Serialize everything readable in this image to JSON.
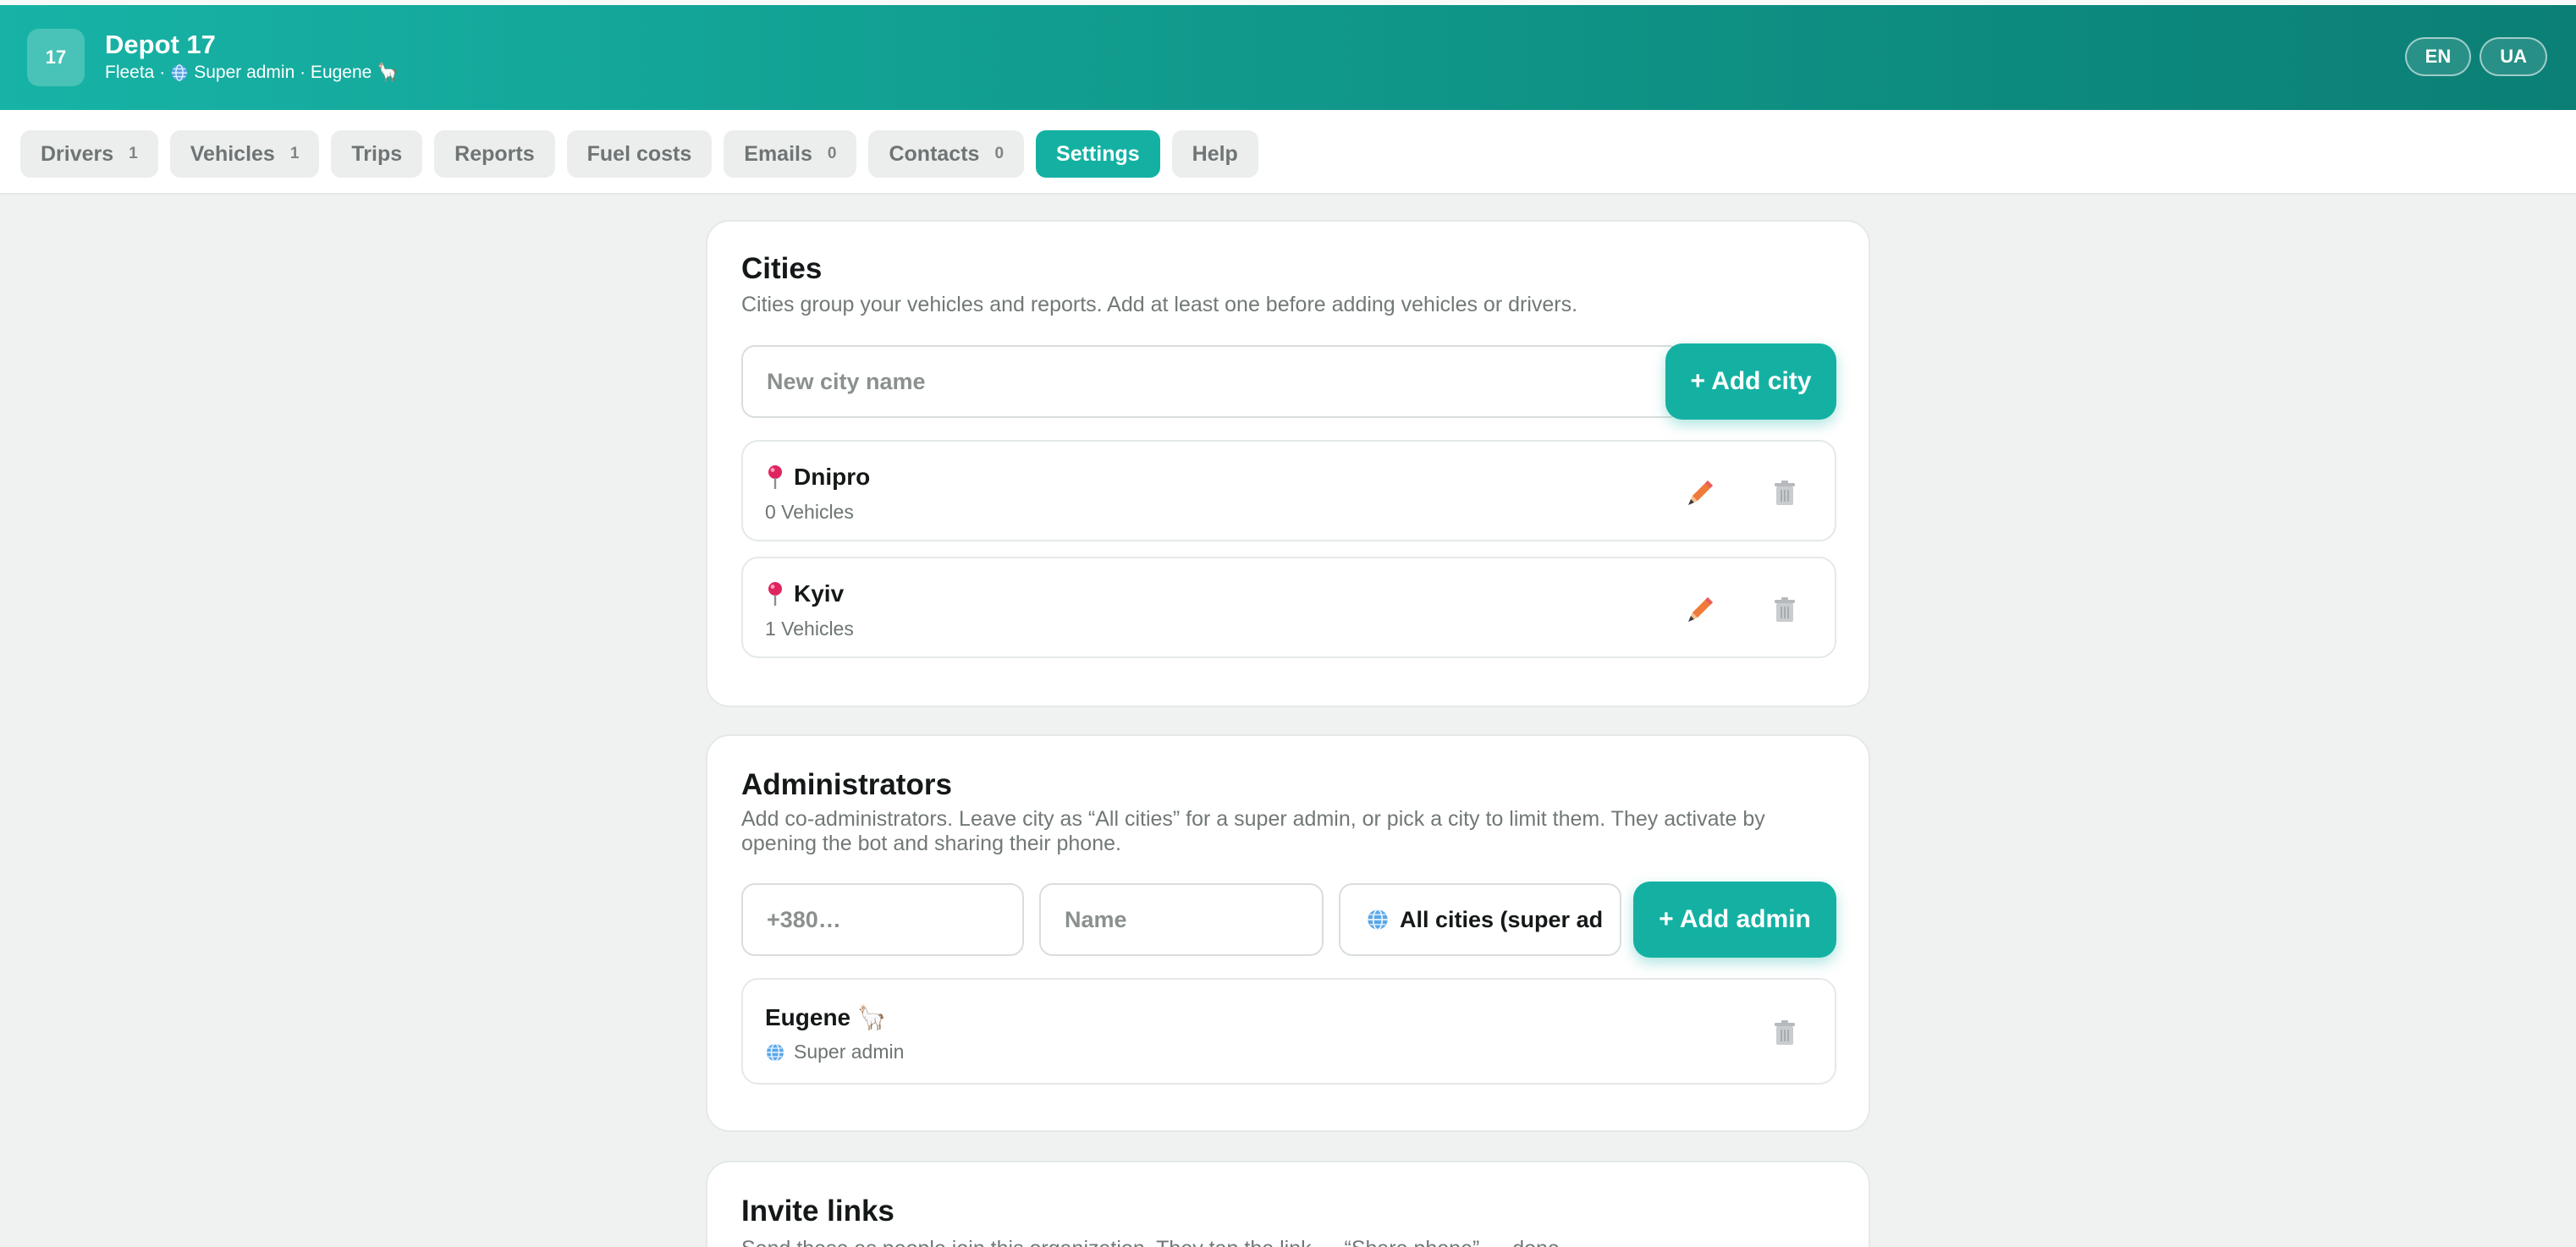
{
  "header": {
    "logo_text": "17",
    "title": "Depot 17",
    "subtitle_prefix": "Fleeta ·",
    "subtitle_role": "Super admin · Eugene 🦙",
    "languages": [
      "EN",
      "UA"
    ]
  },
  "tabs": [
    {
      "label": "Drivers",
      "count": "1"
    },
    {
      "label": "Vehicles",
      "count": "1"
    },
    {
      "label": "Trips",
      "count": ""
    },
    {
      "label": "Reports",
      "count": ""
    },
    {
      "label": "Fuel costs",
      "count": ""
    },
    {
      "label": "Emails",
      "count": "0"
    },
    {
      "label": "Contacts",
      "count": "0"
    },
    {
      "label": "Settings",
      "count": ""
    },
    {
      "label": "Help",
      "count": ""
    }
  ],
  "active_tab": "Settings",
  "cities": {
    "title": "Cities",
    "description": "Cities group your vehicles and reports. Add at least one before adding vehicles or drivers.",
    "input_placeholder": "New city name",
    "add_button": "+ Add city",
    "items": [
      {
        "name": "Dnipro",
        "meta": "0 Vehicles"
      },
      {
        "name": "Kyiv",
        "meta": "1 Vehicles"
      }
    ]
  },
  "administrators": {
    "title": "Administrators",
    "description_line1": "Add co-administrators. Leave city as “All cities” for a super admin, or pick a city to limit them. They activate by",
    "description_line2": "opening the bot and sharing their phone.",
    "phone_placeholder": "+380…",
    "name_placeholder": "Name",
    "city_select": "All cities (super ad",
    "add_button": "+ Add admin",
    "items": [
      {
        "name": "Eugene 🦙",
        "role": "Super admin"
      }
    ]
  },
  "invite_links": {
    "title": "Invite links",
    "description": "Send these as people join this organization. They tap the link → “Share phone” → done."
  },
  "colors": {
    "accent": "#14b1a3",
    "header_start": "#17b3a6",
    "header_end": "#0b7f75",
    "edit_icon": "#ef7a3a",
    "pin_icon": "#e0245e"
  }
}
